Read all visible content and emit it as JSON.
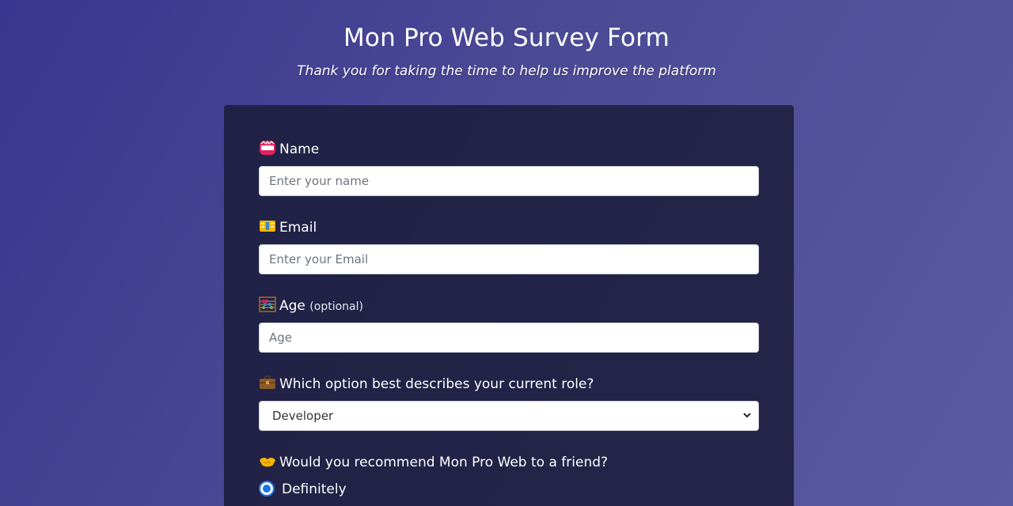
{
  "header": {
    "title": "Mon Pro Web Survey Form",
    "subtitle": "Thank you for taking the time to help us improve the platform"
  },
  "form": {
    "name": {
      "icon": "name-badge-icon",
      "label": "Name",
      "placeholder": "Enter your name",
      "value": ""
    },
    "email": {
      "icon": "email-icon",
      "label": "Email",
      "placeholder": "Enter your Email",
      "value": ""
    },
    "age": {
      "icon": "abacus-icon",
      "label": "Age",
      "optional_label": "(optional)",
      "placeholder": "Age",
      "value": ""
    },
    "role": {
      "icon": "briefcase-icon",
      "label": "Which option best describes your current role?",
      "selected": "Developer"
    },
    "recommend": {
      "icon": "handshake-icon",
      "label": "Would you recommend Mon Pro Web to a friend?",
      "options": [
        "Definitely"
      ],
      "selected": "Definitely"
    }
  },
  "colors": {
    "background_start": "#3a3590",
    "background_end": "#5a5aa0",
    "card": "#1b1c3a",
    "radio_accent": "#1a73e8"
  }
}
